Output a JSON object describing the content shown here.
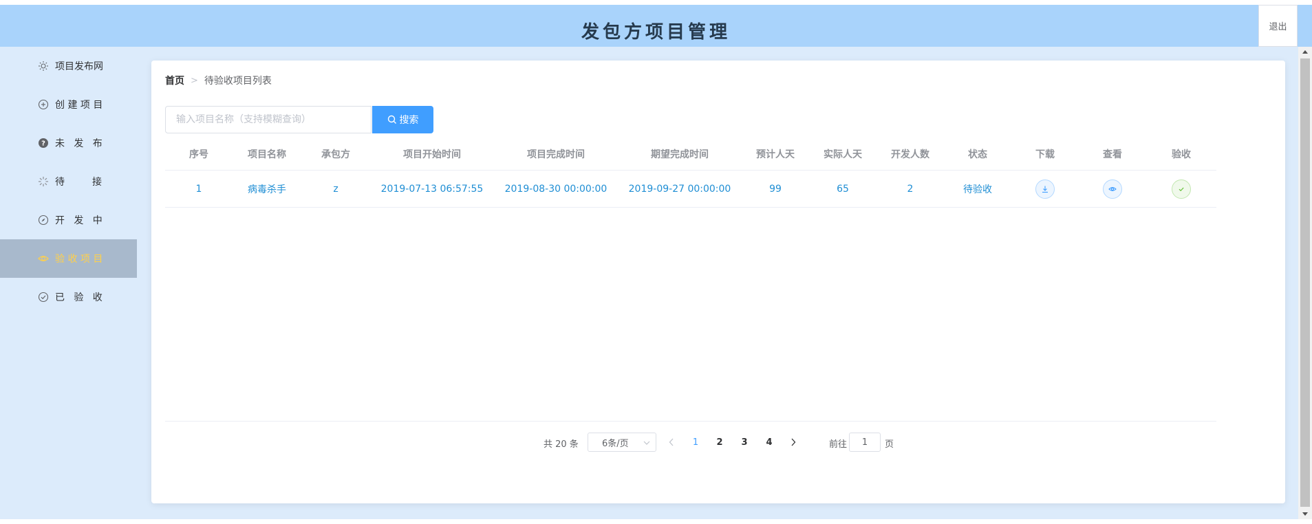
{
  "header": {
    "title": "发包方项目管理",
    "logout_label": "退出"
  },
  "sidebar": {
    "items": [
      {
        "label": "项目发布网",
        "icon": "sun-icon"
      },
      {
        "label": "创 建 项 目",
        "icon": "plus-circle-icon"
      },
      {
        "label": "未   发   布",
        "icon": "question-icon"
      },
      {
        "label": "待         接",
        "icon": "loading-icon"
      },
      {
        "label": "开   发   中",
        "icon": "compass-icon"
      },
      {
        "label": "验 收 项 目",
        "icon": "eye-icon",
        "active": true
      },
      {
        "label": "已   验   收",
        "icon": "check-circle-icon"
      }
    ]
  },
  "breadcrumb": {
    "home": "首页",
    "current": "待验收项目列表"
  },
  "search": {
    "placeholder": "输入项目名称（支持模糊查询）",
    "value": "",
    "button_label": "搜索"
  },
  "table": {
    "headers": [
      "序号",
      "项目名称",
      "承包方",
      "项目开始时间",
      "项目完成时间",
      "期望完成时间",
      "预计人天",
      "实际人天",
      "开发人数",
      "状态",
      "下载",
      "查看",
      "验收"
    ],
    "rows": [
      {
        "index": "1",
        "name": "病毒杀手",
        "contractor": "z",
        "start": "2019-07-13 06:57:55",
        "finish": "2019-08-30 00:00:00",
        "expected": "2019-09-27 00:00:00",
        "est_days": "99",
        "actual_days": "65",
        "devs": "2",
        "status": "待验收"
      }
    ]
  },
  "pagination": {
    "total_text": "共 20 条",
    "page_size": "6条/页",
    "pages": [
      "1",
      "2",
      "3",
      "4"
    ],
    "current_page": "1",
    "goto_label": "前往",
    "goto_value": "1",
    "goto_unit": "页"
  },
  "colors": {
    "header_bg": "#a9d3fb",
    "sidebar_bg": "#dcebfb",
    "active_item_bg": "#a8b9cc",
    "active_item_text": "#ffd04b",
    "primary": "#409eff",
    "cell_text": "#1f8ed4"
  }
}
